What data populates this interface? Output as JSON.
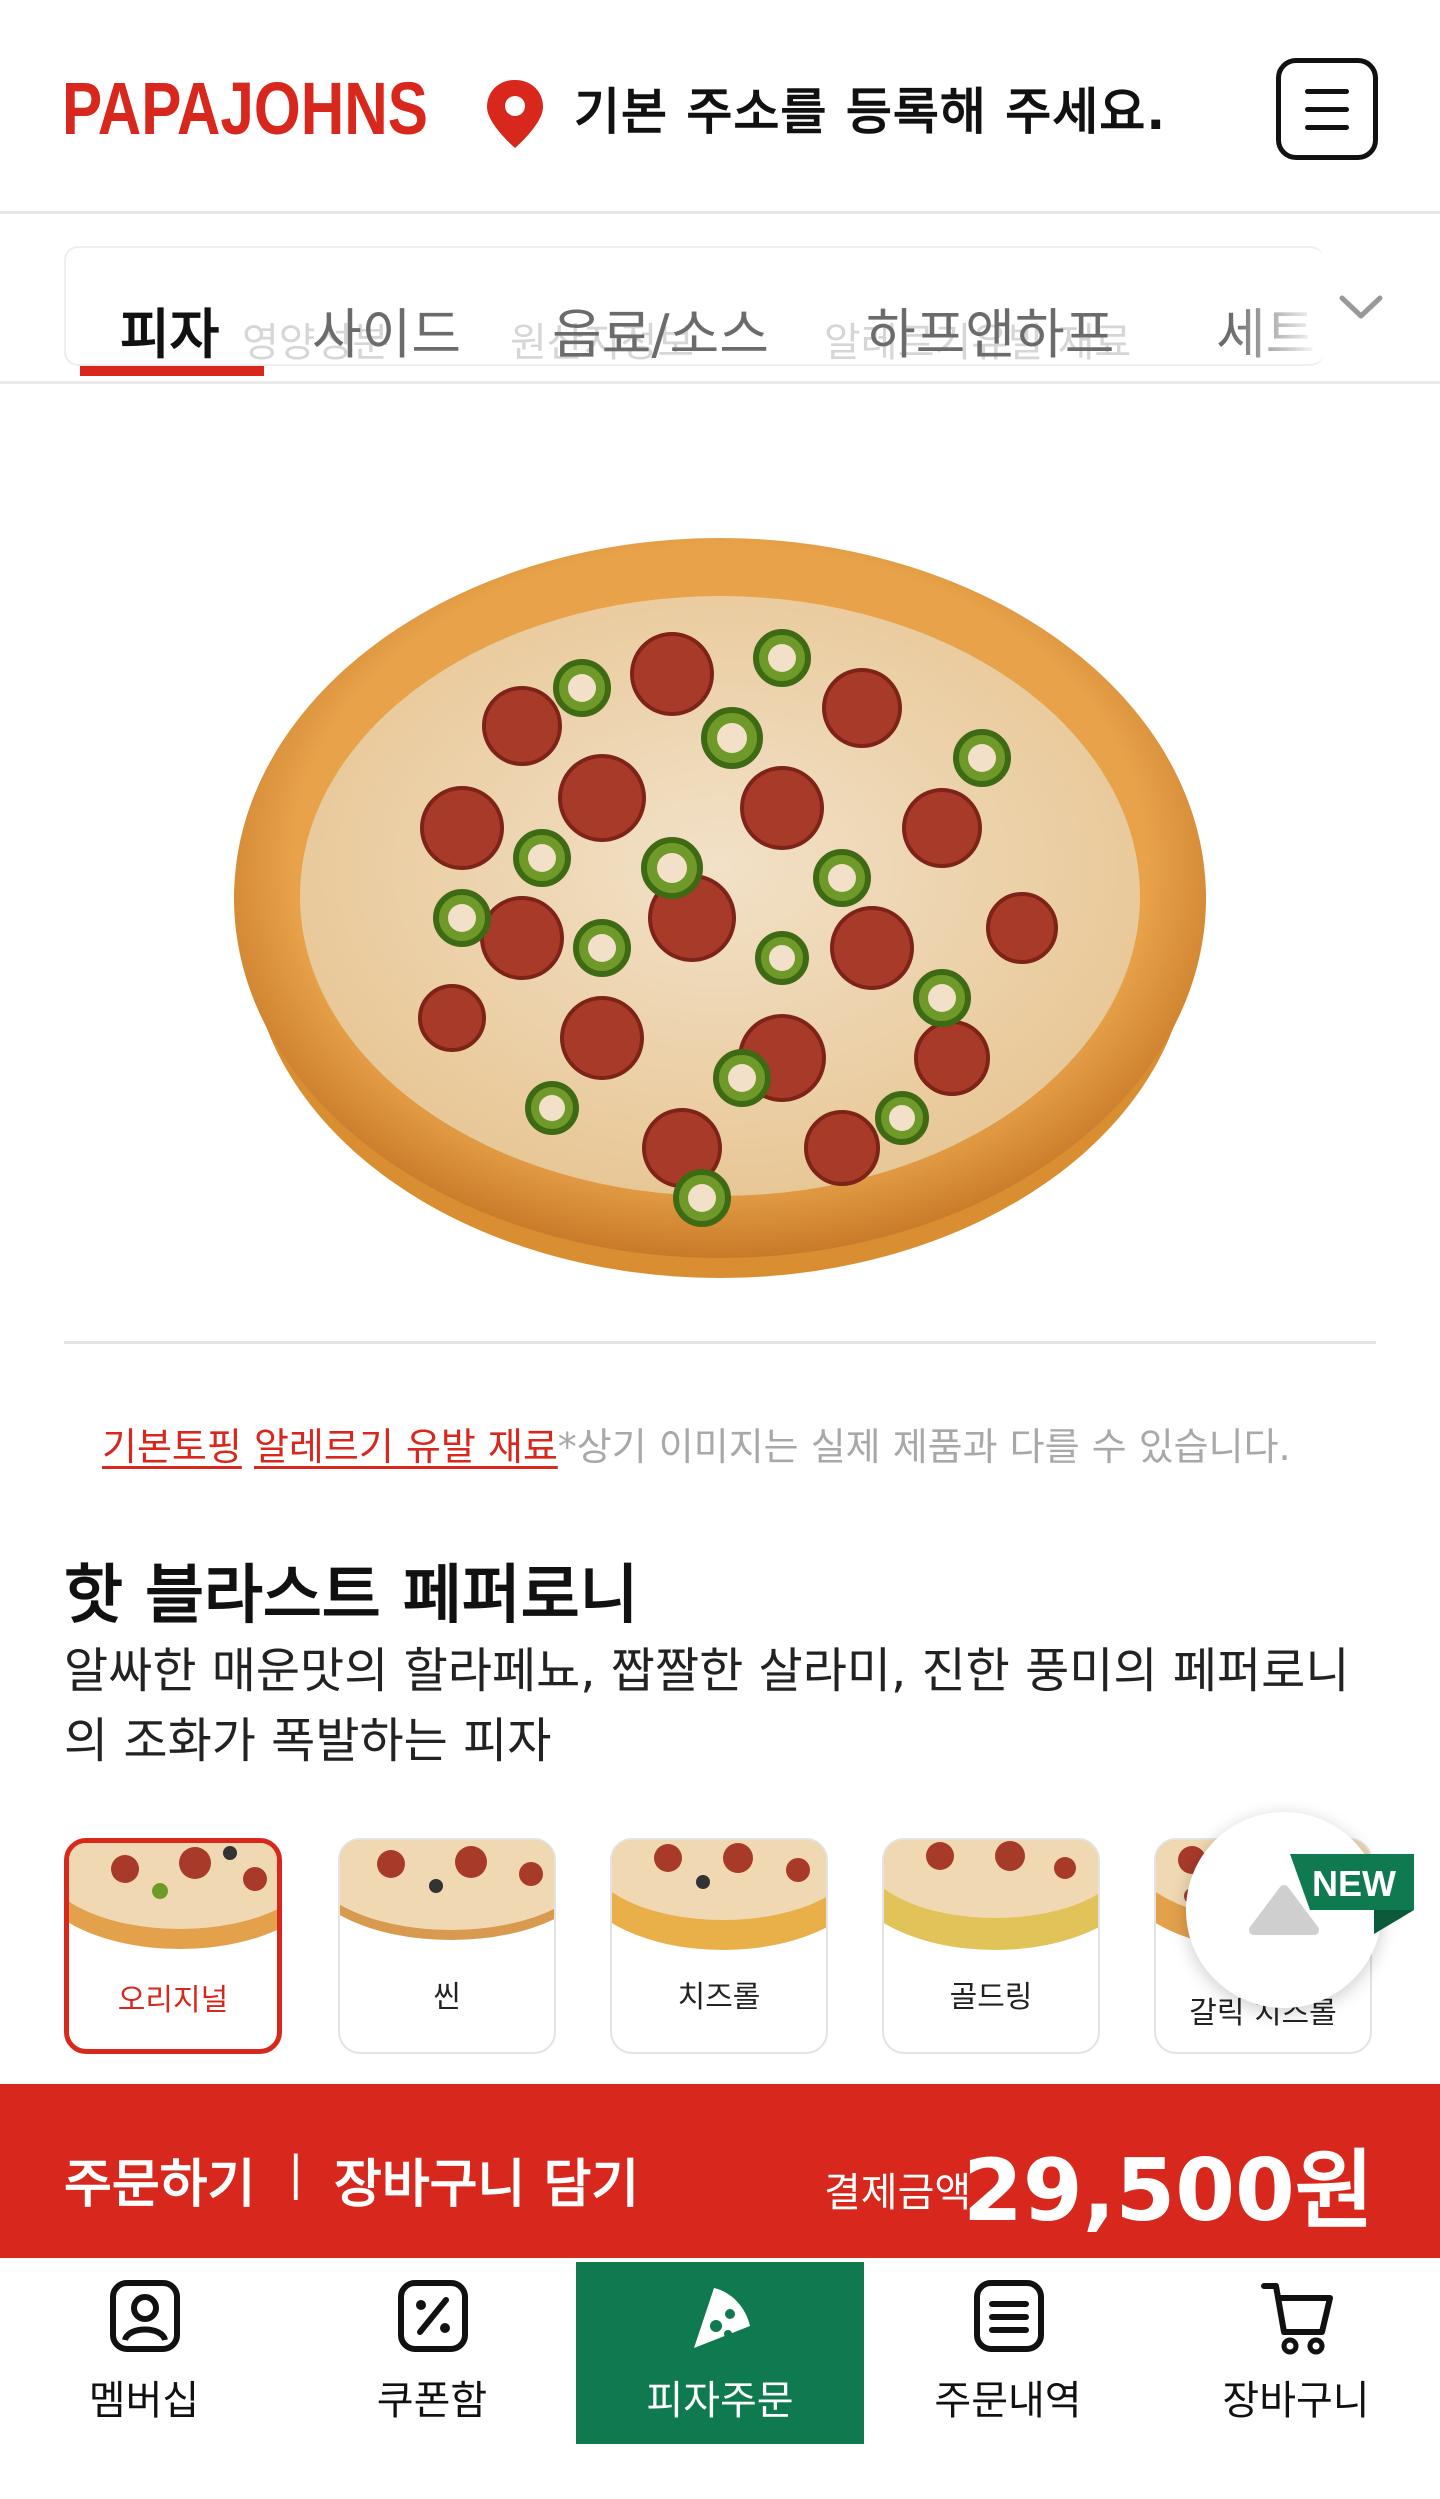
{
  "header": {
    "logo_text": "PAPA JOHNS",
    "address_prompt": "기본 주소를 등록해 주세요."
  },
  "tabs": [
    {
      "label": "피자",
      "active": true
    },
    {
      "label": "사이드",
      "active": false
    },
    {
      "label": "음료/소스",
      "active": false
    },
    {
      "label": "하프앤하프",
      "active": false
    },
    {
      "label": "세트",
      "active": false
    }
  ],
  "sub_links_ghost": [
    "영양성분",
    "원산지정보",
    "알레르기유발 재료"
  ],
  "info": {
    "basic_topping_link": "기본토핑",
    "allergen_link": "알레르기 유발 재료",
    "disclaimer": "*상기 이미지는 실제 제품과 다를 수 있습니다."
  },
  "product": {
    "title": "핫 블라스트 페퍼로니",
    "description": "알싸한 매운맛의 할라페뇨, 짭짤한 살라미, 진한 풍미의 페퍼로니의 조화가 폭발하는 피자"
  },
  "crust_options": [
    {
      "label": "오리지널",
      "selected": true
    },
    {
      "label": "씬",
      "selected": false
    },
    {
      "label": "치즈롤",
      "selected": false
    },
    {
      "label": "골드링",
      "selected": false
    },
    {
      "label": "갈릭 치즈롤",
      "selected": false
    }
  ],
  "badge": {
    "new_label": "NEW"
  },
  "order_bar": {
    "order_label": "주문하기",
    "separator": "|",
    "cart_add_label": "장바구니 담기",
    "price_label": "결제금액",
    "price_value": "29,500원"
  },
  "bottom_nav": [
    {
      "label": "멤버십",
      "icon": "membership-icon",
      "active": false
    },
    {
      "label": "쿠폰함",
      "icon": "coupon-icon",
      "active": false
    },
    {
      "label": "피자주문",
      "icon": "pizza-slice-icon",
      "active": true
    },
    {
      "label": "주문내역",
      "icon": "order-history-icon",
      "active": false
    },
    {
      "label": "장바구니",
      "icon": "cart-icon",
      "active": false
    }
  ],
  "colors": {
    "brand_red": "#d8271c",
    "nav_green": "#0f7a4f",
    "badge_green": "#0f7a4f"
  }
}
